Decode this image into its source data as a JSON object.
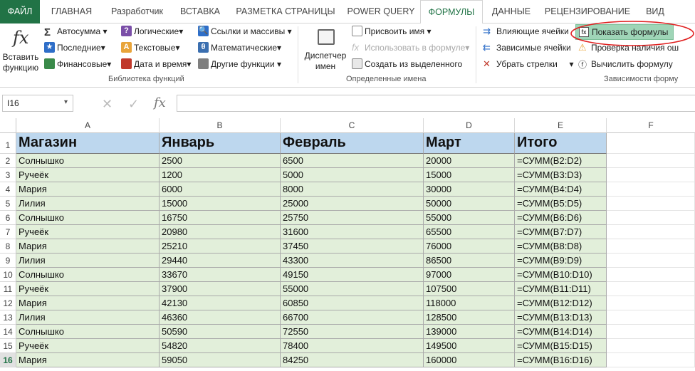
{
  "tabs": [
    "ФАЙЛ",
    "ГЛАВНАЯ",
    "Разработчик",
    "ВСТАВКА",
    "РАЗМЕТКА СТРАНИЦЫ",
    "POWER QUERY",
    "ФОРМУЛЫ",
    "ДАННЫЕ",
    "РЕЦЕНЗИРОВАНИЕ",
    "ВИД"
  ],
  "active_tab": "ФОРМУЛЫ",
  "ribbon": {
    "function_library": {
      "insert_function": "Вставить функцию",
      "autosum": "Автосумма",
      "recent": "Последние",
      "financial": "Финансовые",
      "logical": "Логические",
      "text": "Текстовые",
      "date_time": "Дата и время",
      "lookup": "Ссылки и массивы",
      "math": "Математические",
      "other": "Другие функции",
      "label": "Библиотека функций"
    },
    "defined_names": {
      "name_manager": "Диспетчер имен",
      "define_name": "Присвоить имя",
      "use_in_formula": "Использовать в формуле",
      "create_from_selection": "Создать из выделенного",
      "label": "Определенные имена"
    },
    "formula_auditing": {
      "trace_precedents": "Влияющие ячейки",
      "trace_dependents": "Зависимые ячейки",
      "remove_arrows": "Убрать стрелки",
      "show_formulas": "Показать формулы",
      "error_checking": "Проверка наличия ош",
      "evaluate_formula": "Вычислить формулу",
      "label": "Зависимости форму"
    }
  },
  "formula_bar": {
    "name_box": "I16",
    "formula": ""
  },
  "sheet": {
    "columns": [
      "A",
      "B",
      "C",
      "D",
      "E",
      "F"
    ],
    "header_row": [
      "Магазин",
      "Январь",
      "Февраль",
      "Март",
      "Итого"
    ],
    "rows": [
      [
        "Солнышко",
        "2500",
        "6500",
        "20000",
        "=СУММ(B2:D2)"
      ],
      [
        "Ручеёк",
        "1200",
        "5000",
        "15000",
        "=СУММ(B3:D3)"
      ],
      [
        "Мария",
        "6000",
        "8000",
        "30000",
        "=СУММ(B4:D4)"
      ],
      [
        "Лилия",
        "15000",
        "25000",
        "50000",
        "=СУММ(B5:D5)"
      ],
      [
        "Солнышко",
        "16750",
        "25750",
        "55000",
        "=СУММ(B6:D6)"
      ],
      [
        "Ручеёк",
        "20980",
        "31600",
        "65500",
        "=СУММ(B7:D7)"
      ],
      [
        "Мария",
        "25210",
        "37450",
        "76000",
        "=СУММ(B8:D8)"
      ],
      [
        "Лилия",
        "29440",
        "43300",
        "86500",
        "=СУММ(B9:D9)"
      ],
      [
        "Солнышко",
        "33670",
        "49150",
        "97000",
        "=СУММ(B10:D10)"
      ],
      [
        "Ручеёк",
        "37900",
        "55000",
        "107500",
        "=СУММ(B11:D11)"
      ],
      [
        "Мария",
        "42130",
        "60850",
        "118000",
        "=СУММ(B12:D12)"
      ],
      [
        "Лилия",
        "46360",
        "66700",
        "128500",
        "=СУММ(B13:D13)"
      ],
      [
        "Солнышко",
        "50590",
        "72550",
        "139000",
        "=СУММ(B14:D14)"
      ],
      [
        "Ручеёк",
        "54820",
        "78400",
        "149500",
        "=СУММ(B15:D15)"
      ],
      [
        "Мария",
        "59050",
        "84250",
        "160000",
        "=СУММ(B16:D16)"
      ]
    ],
    "row_numbers": [
      "1",
      "2",
      "3",
      "4",
      "5",
      "6",
      "7",
      "8",
      "9",
      "10",
      "11",
      "12",
      "13",
      "14",
      "15",
      "16"
    ],
    "selected_row": "16"
  },
  "colors": {
    "excel_green": "#217346",
    "header_fill": "#bdd7ee",
    "data_fill": "#e2efda",
    "annotation_red": "#e02020"
  }
}
